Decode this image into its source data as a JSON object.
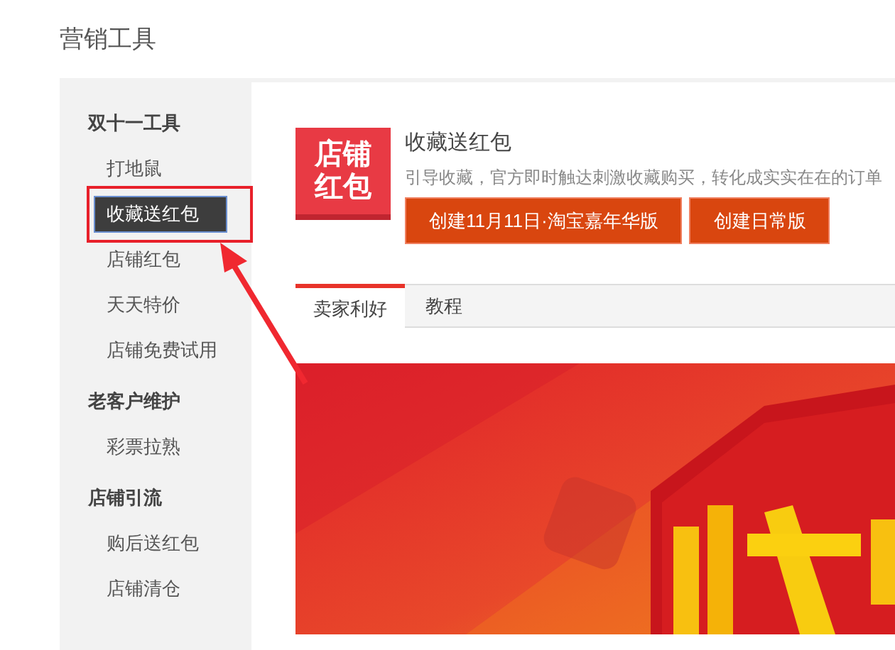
{
  "page_title": "营销工具",
  "sidebar": {
    "groups": [
      {
        "title": "双十一工具",
        "items": [
          {
            "label": "打地鼠",
            "selected": false
          },
          {
            "label": "收藏送红包",
            "selected": true
          },
          {
            "label": "店铺红包",
            "selected": false
          },
          {
            "label": "天天特价",
            "selected": false
          },
          {
            "label": "店铺免费试用",
            "selected": false
          }
        ]
      },
      {
        "title": "老客户维护",
        "items": [
          {
            "label": "彩票拉熟",
            "selected": false
          }
        ]
      },
      {
        "title": "店铺引流",
        "items": [
          {
            "label": "购后送红包",
            "selected": false
          },
          {
            "label": "店铺清仓",
            "selected": false
          }
        ]
      }
    ]
  },
  "tool": {
    "logo_lines": [
      "店铺",
      "红包"
    ],
    "title": "收藏送红包",
    "description": "引导收藏，官方即时触达刺激收藏购买，转化成实实在在的订单",
    "buttons": [
      "创建11月11日·淘宝嘉年华版",
      "创建日常版"
    ]
  },
  "tabs": [
    {
      "label": "卖家利好",
      "selected": true
    },
    {
      "label": "教程",
      "selected": false
    }
  ]
}
